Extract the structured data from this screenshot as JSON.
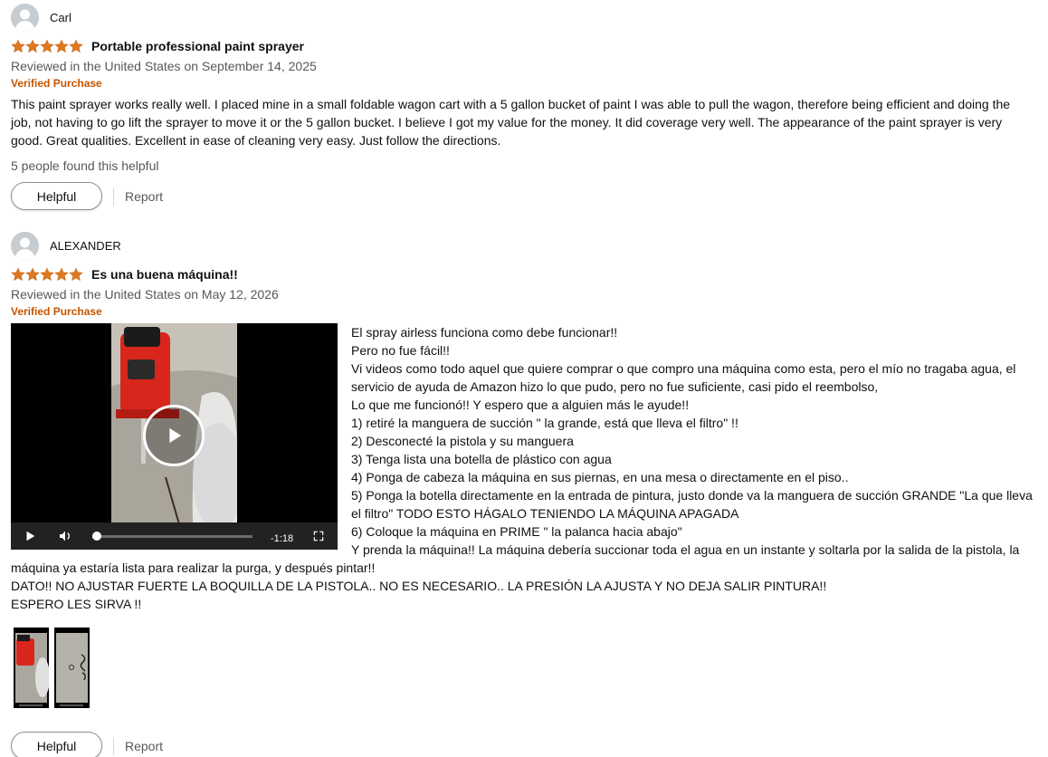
{
  "reviews": [
    {
      "profile_name": "Carl",
      "rating": 5,
      "title": "Portable professional paint sprayer",
      "date_text": "Reviewed in the United States on September 14, 2025",
      "verified_label": "Verified Purchase",
      "body": "This paint sprayer works really well. I placed mine in a small foldable wagon cart with a 5 gallon bucket of paint I was able to pull the wagon, therefore being efficient and doing the job, not having to go lift the sprayer to move it or the 5 gallon bucket. I believe I got my value for the money. It did coverage very well. The appearance of the paint sprayer is very good. Great qualities. Excellent in ease of cleaning very easy. Just follow the directions.",
      "helpful_count_text": "5 people found this helpful",
      "helpful_label": "Helpful",
      "report_label": "Report"
    },
    {
      "profile_name": "ALEXANDER",
      "rating": 5,
      "title": "Es una buena máquina!!",
      "date_text": "Reviewed in the United States on May 12, 2026",
      "verified_label": "Verified Purchase",
      "video": {
        "time_remaining": "-1:18",
        "progress": 0.03
      },
      "body_lines": [
        "El spray airless funciona como debe funcionar!!",
        "Pero no fue fácil!!",
        "Vi videos como todo aquel que quiere comprar o que compro una máquina como esta, pero el mío no tragaba agua, el servicio de ayuda de Amazon hizo lo que pudo, pero no fue suficiente, casi pido el reembolso,",
        "Lo que me funcionó!! Y espero que a alguien más le ayude!!",
        "1) retiré la manguera de succión \" la grande, está que lleva el filtro\" !!",
        "2) Desconecté la pistola y su manguera",
        "3) Tenga lista una botella de plástico con agua",
        "4) Ponga de cabeza la máquina en sus piernas, en una mesa o directamente en el piso..",
        "5) Ponga la botella directamente en la entrada de pintura, justo donde va la manguera de succión GRANDE \"La que lleva el filtro\" TODO ESTO HÁGALO TENIENDO LA MÁQUINA APAGADA",
        "6) Coloque la máquina en PRIME \" la palanca hacia abajo\"",
        "Y prenda la máquina!! La máquina debería succionar toda el agua en un instante y soltarla por la salida de la pistola, la máquina ya estaría lista para realizar la purga, y después pintar!!",
        "DATO!! NO AJUSTAR FUERTE LA BOQUILLA DE LA PISTOLA.. NO ES NECESARIO.. LA PRESIÓN LA AJUSTA Y NO DEJA SALIR PINTURA!!",
        "ESPERO LES SIRVA !!"
      ],
      "helpful_label": "Helpful",
      "report_label": "Report"
    }
  ],
  "colors": {
    "star": "#de7921",
    "verified": "#c45500",
    "muted_text": "#565959"
  },
  "icons": [
    "user-avatar-icon",
    "star-icon",
    "play-icon",
    "volume-icon",
    "fullscreen-icon"
  ]
}
